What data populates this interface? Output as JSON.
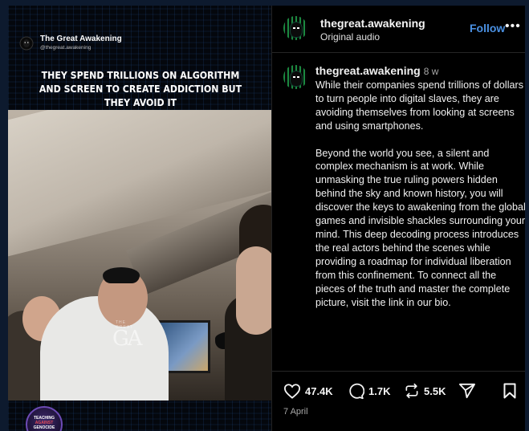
{
  "media": {
    "brand_name": "The Great Awakening",
    "brand_handle": "@thegreat.awakening",
    "headline_line1": "THEY SPEND TRILLIONS ON ALGORITHM",
    "headline_line2": "AND SCREEN TO CREATE ADDICTION BUT THEY AVOID IT",
    "watermark": "GA",
    "watermark_small": "THE GREAT",
    "badge_lines": [
      "TEACHING",
      "AGAINST",
      "GENOCIDE"
    ]
  },
  "header": {
    "username": "thegreat.awakening",
    "subtitle": "Original audio",
    "follow_label": "Follow",
    "more_label": "•••"
  },
  "caption": {
    "username": "thegreat.awakening",
    "time_ago": "8 w",
    "paragraph1": "While their companies spend trillions of dollars to turn people into digital slaves, they are avoiding themselves from looking at screens and using smartphones.",
    "paragraph2": "Beyond the world you see, a silent and complex mechanism is at work. While unmasking the true ruling powers hidden behind the sky and known history, you will discover the keys to awakening from the global games and invisible shackles surrounding your mind. This deep decoding process introduces the real actors behind the scenes while providing a roadmap for individual liberation from this confinement. To connect all the pieces of the truth and master the complete picture, visit the link in our bio."
  },
  "actions": {
    "likes": "47.4K",
    "comments": "1.7K",
    "reposts": "5.5K",
    "date": "7 April",
    "icons": [
      "heart-icon",
      "comment-icon",
      "repost-icon",
      "share-icon",
      "bookmark-icon"
    ]
  },
  "colors": {
    "follow": "#4a90e2",
    "avatar_green": "#1fa04a",
    "page_bg": "#0d1a2e"
  }
}
